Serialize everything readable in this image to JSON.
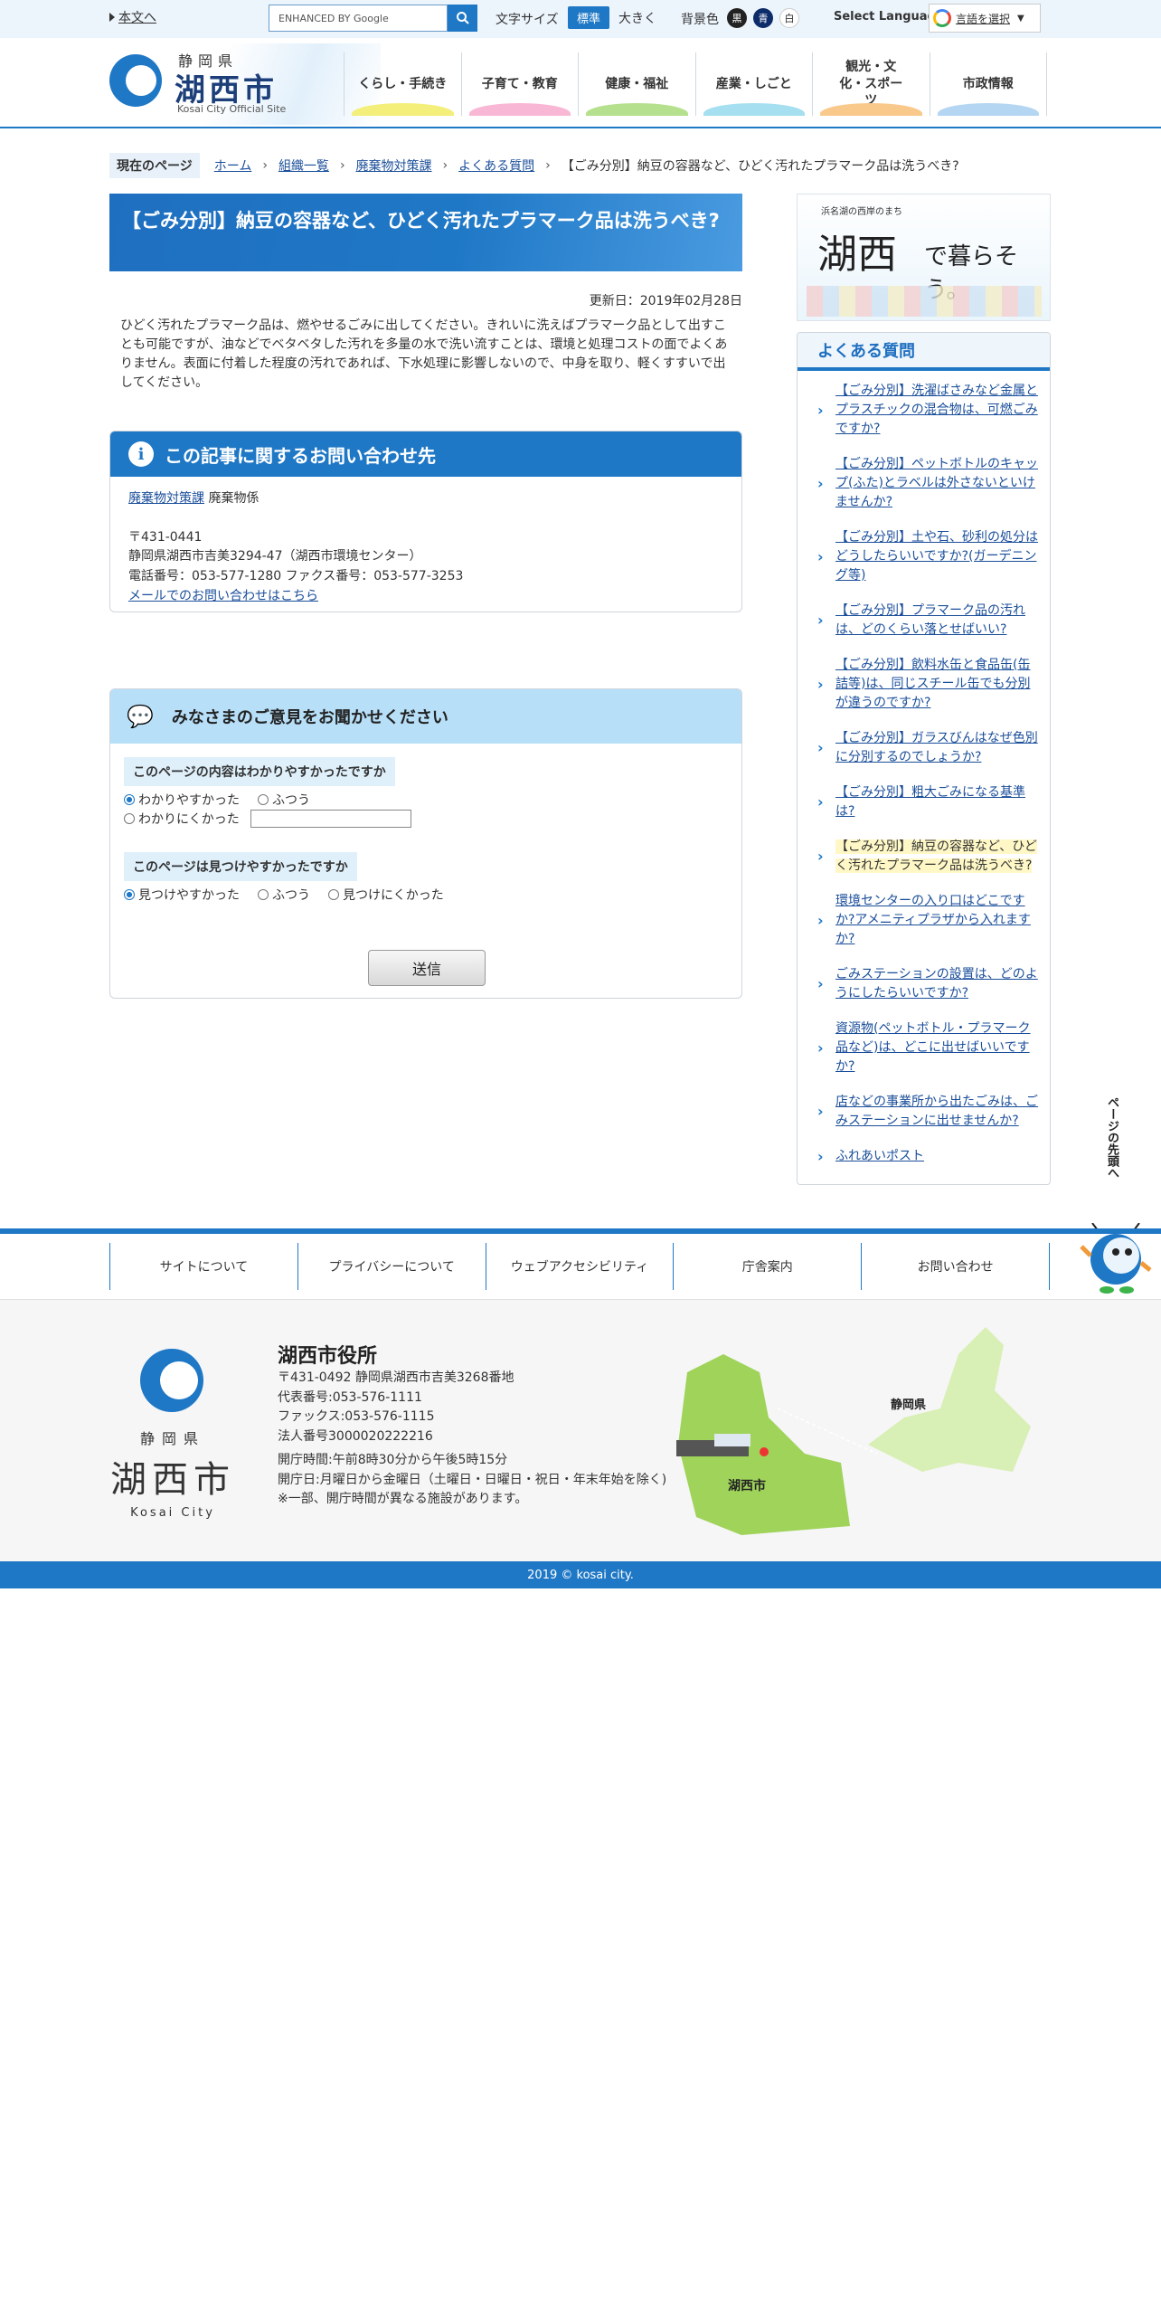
{
  "topbar": {
    "skip_link": "本文へ",
    "search_placeholder": "ENHANCED BY Google",
    "font_size_label": "文字サイズ",
    "font_standard": "標準",
    "font_large": "大きく",
    "bg_color_label": "背景色",
    "bg_black": "黒",
    "bg_blue": "青",
    "bg_white": "白",
    "language_label": "Select Language",
    "language_select": "言語を選択"
  },
  "header": {
    "logo_pref": "静岡県",
    "logo_city": "湖西市",
    "logo_sub": "Kosai City Official Site",
    "nav": [
      {
        "label": "くらし・手続き"
      },
      {
        "label": "子育て・教育"
      },
      {
        "label": "健康・福祉"
      },
      {
        "label": "産業・しごと"
      },
      {
        "label": "観光・文化・スポーツ"
      },
      {
        "label": "市政情報"
      }
    ]
  },
  "breadcrumb": {
    "here_label": "現在のページ",
    "links": [
      "ホーム",
      "組織一覧",
      "廃棄物対策課",
      "よくある質問"
    ],
    "current": "【ごみ分別】納豆の容器など、ひどく汚れたプラマーク品は洗うべき?"
  },
  "article": {
    "title": "【ごみ分別】納豆の容器など、ひどく汚れたプラマーク品は洗うべき?",
    "updated": "更新日：2019年02月28日",
    "body": "ひどく汚れたプラマーク品は、燃やせるごみに出してください。きれいに洗えばプラマーク品として出すことも可能ですが、油などでベタベタした汚れを多量の水で洗い流すことは、環境と処理コストの面でよくありません。表面に付着した程度の汚れであれば、下水処理に影響しないので、中身を取り、軽くすすいで出してください。"
  },
  "contact": {
    "heading": "この記事に関するお問い合わせ先",
    "dept_link": "廃棄物対策課",
    "section": "廃棄物係",
    "postal": "〒431-0441",
    "address": "静岡県湖西市吉美3294-47（湖西市環境センター）",
    "phone": "電話番号：053-577-1280 ファクス番号：053-577-3253",
    "mail_link": "メールでのお問い合わせはこちら"
  },
  "feedback": {
    "heading": "みなさまのご意見をお聞かせください",
    "q1": "このページの内容はわかりやすかったですか",
    "q1_opt1": "わかりやすかった",
    "q1_opt2": "ふつう",
    "q1_opt3": "わかりにくかった",
    "q2": "このページは見つけやすかったですか",
    "q2_opt1": "見つけやすかった",
    "q2_opt2": "ふつう",
    "q2_opt3": "見つけにくかった",
    "submit": "送信"
  },
  "sidebar": {
    "banner_small": "浜名湖の西岸のまち",
    "banner_big": "湖西",
    "banner_big2": "で暮らそう。",
    "faq_heading": "よくある質問",
    "faq": [
      "【ごみ分別】洗濯ばさみなど金属とプラスチックの混合物は、可燃ごみですか?",
      "【ごみ分別】ペットボトルのキャップ(ふた)とラベルは外さないといけませんか?",
      "【ごみ分別】土や石、砂利の処分はどうしたらいいですか?(ガーデニング等)",
      "【ごみ分別】プラマーク品の汚れは、どのくらい落とせばいい?",
      "【ごみ分別】飲料水缶と食品缶(缶詰等)は、同じスチール缶でも分別が違うのですか?",
      "【ごみ分別】ガラスびんはなぜ色別に分別するのでしょうか?",
      "【ごみ分別】粗大ごみになる基準は?",
      "【ごみ分別】納豆の容器など、ひどく汚れたプラマーク品は洗うべき?",
      "環境センターの入り口はどこですか?アメニティプラザから入れますか?",
      "ごみステーションの設置は、どのようにしたらいいですか?",
      "資源物(ペットボトル・プラマーク品など)は、どこに出せばいいですか?",
      "店などの事業所から出たごみは、ごみステーションに出せませんか?",
      "ふれあいポスト"
    ],
    "pagetop": "ページの先頭へ"
  },
  "footer": {
    "nav": [
      "サイトについて",
      "プライバシーについて",
      "ウェブアクセシビリティ",
      "庁舎案内",
      "お問い合わせ"
    ],
    "logo_pref": "静岡県",
    "logo_city": "湖西市",
    "logo_sub": "Kosai City",
    "office": "湖西市役所",
    "address": "〒431-0492 静岡県湖西市吉美3268番地",
    "phone": "代表番号:053-576-1111",
    "fax": "ファックス:053-576-1115",
    "corp_no": "法人番号3000020222216",
    "hours": "開庁時間:午前8時30分から午後5時15分",
    "days": "開庁日:月曜日から金曜日（土曜日・日曜日・祝日・年末年始を除く)",
    "note": "※一部、開庁時間が異なる施設があります。",
    "map_city": "湖西市",
    "map_pref": "静岡県",
    "copyright": "2019 © kosai city."
  }
}
